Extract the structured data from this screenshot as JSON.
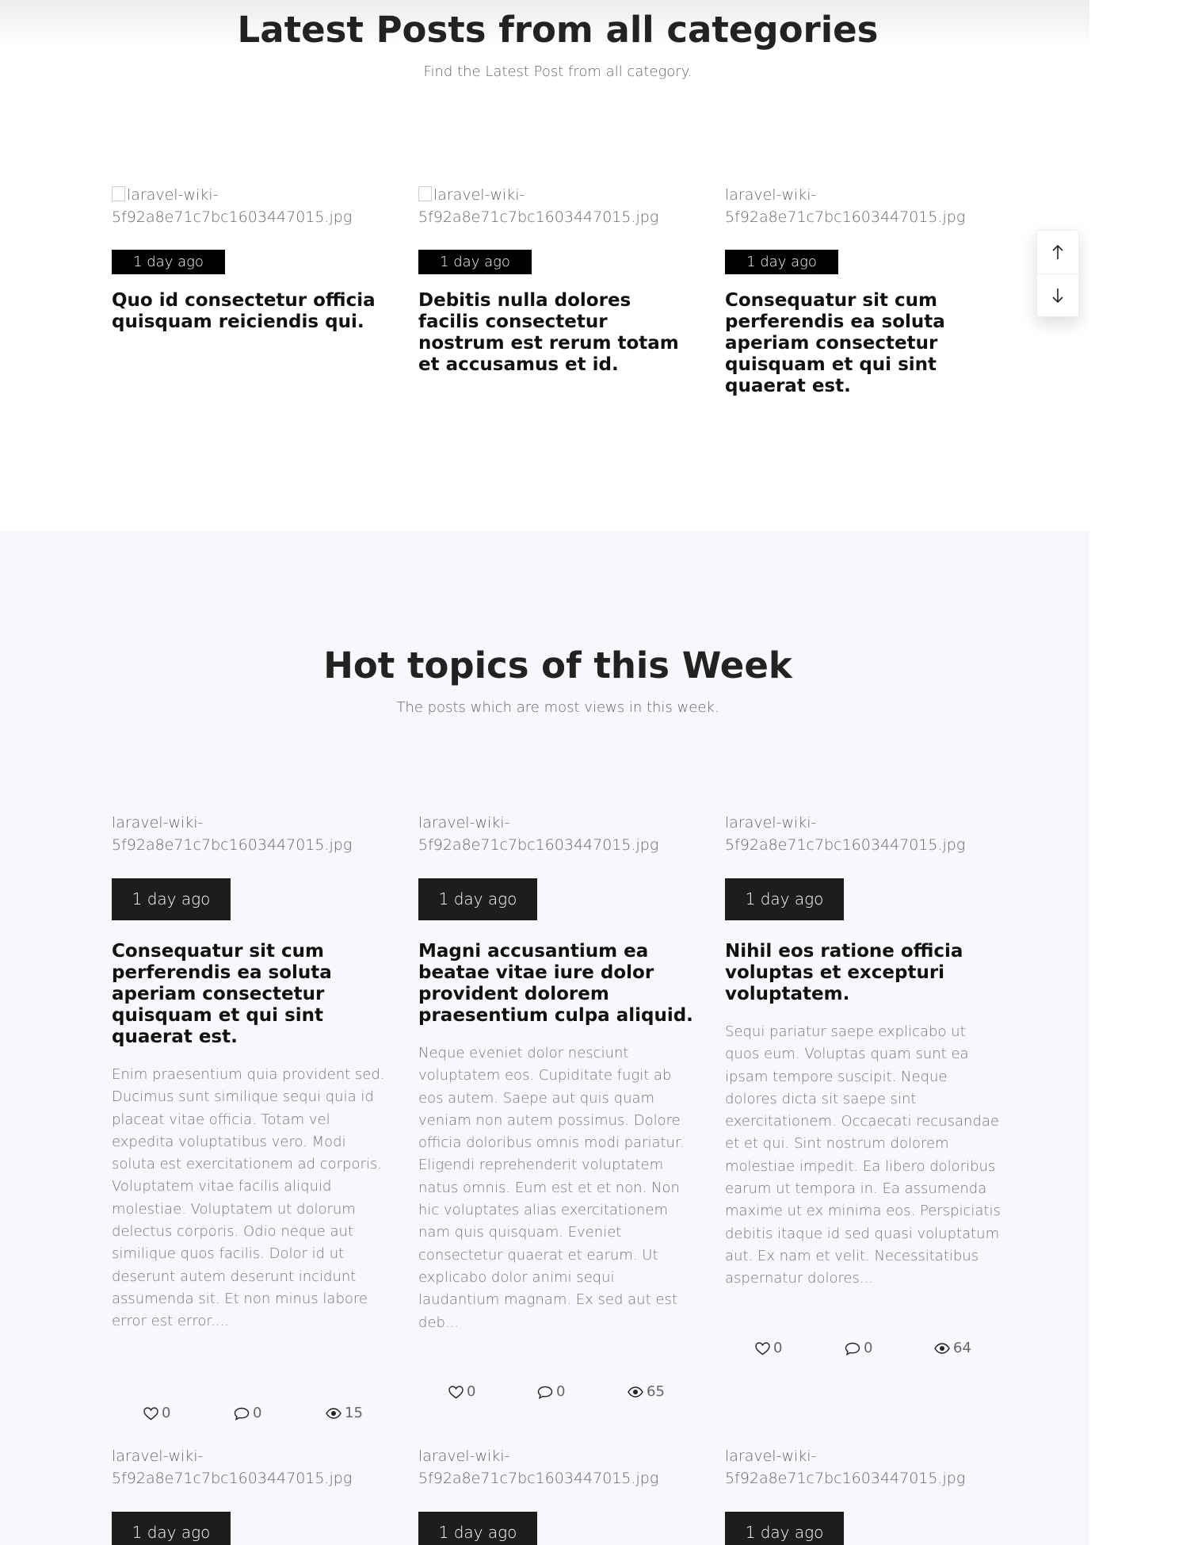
{
  "latest": {
    "title": "Latest Posts from all categories",
    "subtitle": "Find the Latest Post from all category.",
    "posts": [
      {
        "image_alt": "laravel-wiki-5f92a8e71c7bc1603447015.jpg",
        "date": "1 day ago",
        "title": "Quo id consectetur officia quisquam reiciendis qui."
      },
      {
        "image_alt": "laravel-wiki-5f92a8e71c7bc1603447015.jpg",
        "date": "1 day ago",
        "title": "Debitis nulla dolores facilis consectetur nostrum est rerum totam et accusamus et id."
      },
      {
        "image_alt": "laravel-wiki-5f92a8e71c7bc1603447015.jpg",
        "date": "1 day ago",
        "title": "Consequatur sit cum perferendis ea soluta aperiam consectetur quisquam et qui sint quaerat est."
      }
    ]
  },
  "hot": {
    "title": "Hot topics of this Week",
    "subtitle": "The posts which are most views in this week.",
    "posts": [
      {
        "image_alt": "laravel-wiki-5f92a8e71c7bc1603447015.jpg",
        "date": "1 day ago",
        "title": "Consequatur sit cum perferendis ea soluta aperiam consectetur quisquam et qui sint quaerat est.",
        "excerpt": "Enim praesentium quia provident sed. Ducimus sunt similique sequi quia id placeat vitae officia. Totam vel expedita voluptatibus vero. Modi soluta est exercitationem ad corporis. Voluptatem vitae facilis aliquid molestiae. Voluptatem ut dolorum delectus corporis. Odio neque aut similique quos facilis. Dolor id ut deserunt autem deserunt incidunt assumenda sit. Et non minus labore error est error....",
        "likes": "0",
        "comments": "0",
        "views": "15"
      },
      {
        "image_alt": "laravel-wiki-5f92a8e71c7bc1603447015.jpg",
        "date": "1 day ago",
        "title": "Magni accusantium ea beatae vitae iure dolor provident dolorem praesentium culpa aliquid.",
        "excerpt": "Neque eveniet dolor nesciunt voluptatem eos. Cupiditate fugit ab eos autem. Saepe aut quis quam veniam non autem possimus. Dolore officia doloribus omnis modi pariatur. Eligendi reprehenderit voluptatem natus omnis. Eum est et et non. Non hic voluptates alias exercitationem nam quis quisquam. Eveniet consectetur quaerat et earum. Ut explicabo dolor animi sequi laudantium magnam. Ex sed aut est deb...",
        "likes": "0",
        "comments": "0",
        "views": "65"
      },
      {
        "image_alt": "laravel-wiki-5f92a8e71c7bc1603447015.jpg",
        "date": "1 day ago",
        "title": "Nihil eos ratione officia voluptas et excepturi voluptatem.",
        "excerpt": "Sequi pariatur saepe explicabo ut quos eum. Voluptas quam sunt ea ipsam tempore suscipit. Neque dolores dicta sit saepe sint exercitationem. Occaecati recusandae et et qui. Sint nostrum dolorem molestiae impedit. Ea libero doloribus earum ut tempora in. Ea assumenda maxime ut ex minima eos. Perspiciatis debitis itaque id sed quasi voluptatum aut. Ex nam et velit. Necessitatibus aspernatur dolores...",
        "likes": "0",
        "comments": "0",
        "views": "64"
      },
      {
        "image_alt": "laravel-wiki-5f92a8e71c7bc1603447015.jpg",
        "date": "1 day ago"
      },
      {
        "image_alt": "laravel-wiki-5f92a8e71c7bc1603447015.jpg",
        "date": "1 day ago"
      },
      {
        "image_alt": "laravel-wiki-5f92a8e71c7bc1603447015.jpg",
        "date": "1 day ago"
      }
    ]
  },
  "scroll_controls": {
    "up_icon": "arrow-up-icon",
    "down_icon": "arrow-down-icon"
  }
}
